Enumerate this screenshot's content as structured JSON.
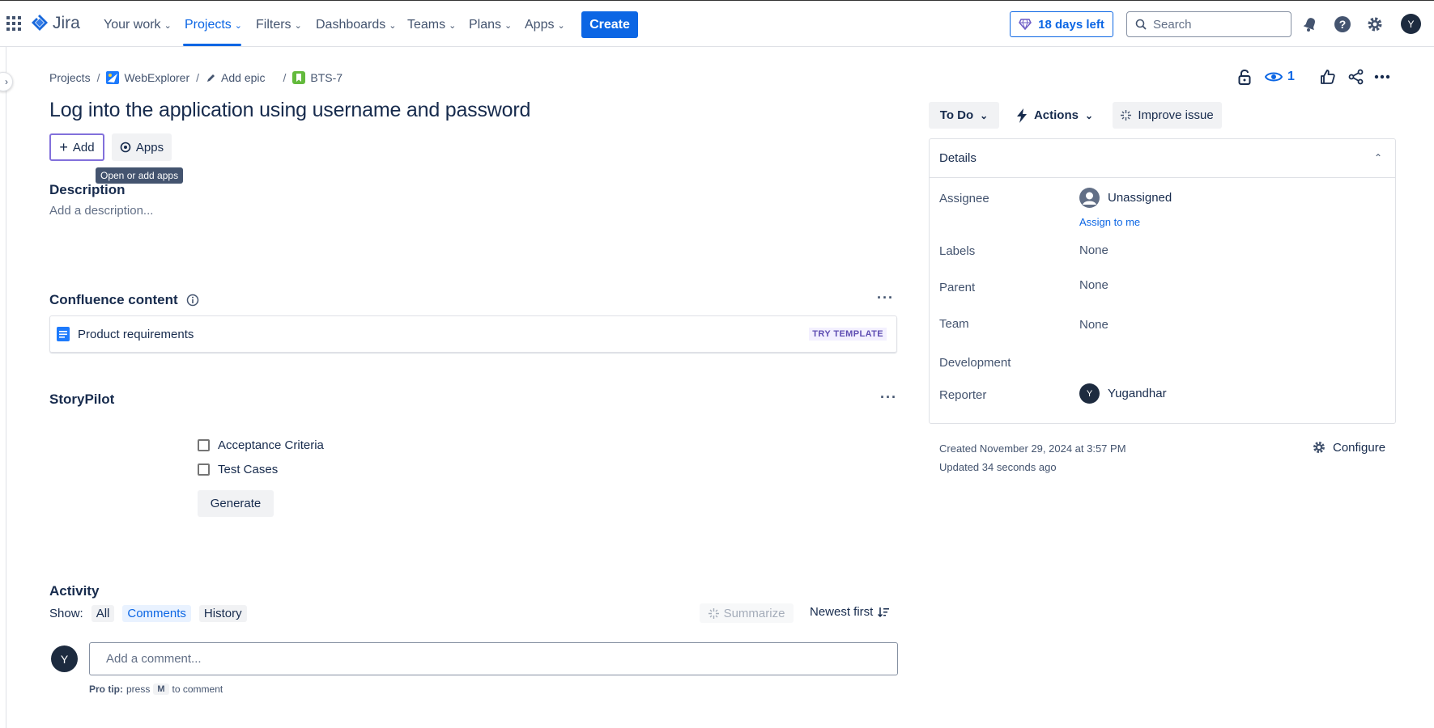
{
  "nav": {
    "logo_text": "Jira",
    "items": [
      {
        "label": "Your work"
      },
      {
        "label": "Projects"
      },
      {
        "label": "Filters"
      },
      {
        "label": "Dashboards"
      },
      {
        "label": "Teams"
      },
      {
        "label": "Plans"
      },
      {
        "label": "Apps"
      }
    ],
    "create_label": "Create",
    "trial_label": "18 days left",
    "search_placeholder": "Search",
    "user_initial": "Y",
    "brand_color": "#0c66e4"
  },
  "breadcrumb": {
    "projects": "Projects",
    "project_name": "WebExplorer",
    "add_epic": "Add epic",
    "issue_key": "BTS-7"
  },
  "issue": {
    "title": "Log into the application using username and password",
    "add_label": "Add",
    "apps_label": "Apps",
    "apps_tooltip": "Open or add apps",
    "watch_count": "1"
  },
  "description": {
    "heading": "Description",
    "placeholder": "Add a description..."
  },
  "confluence": {
    "heading": "Confluence content",
    "item_label": "Product requirements",
    "badge": "TRY TEMPLATE"
  },
  "storypilot": {
    "heading": "StoryPilot",
    "options": [
      "Acceptance Criteria",
      "Test Cases"
    ],
    "generate_label": "Generate"
  },
  "activity": {
    "heading": "Activity",
    "show_label": "Show:",
    "filters": [
      "All",
      "Comments",
      "History"
    ],
    "active_filter": "Comments",
    "summarize_label": "Summarize",
    "sort_label": "Newest first",
    "comment_placeholder": "Add a comment...",
    "pro_tip_bold": "Pro tip:",
    "pro_tip_press": "press",
    "pro_tip_key": "M",
    "pro_tip_rest": "to comment",
    "user_initial": "Y"
  },
  "sidebar": {
    "status_label": "To Do",
    "actions_label": "Actions",
    "improve_label": "Improve issue",
    "details_heading": "Details",
    "fields": {
      "assignee_label": "Assignee",
      "assignee_value": "Unassigned",
      "assign_to_me": "Assign to me",
      "labels_label": "Labels",
      "labels_value": "None",
      "parent_label": "Parent",
      "parent_value": "None",
      "team_label": "Team",
      "team_value": "None",
      "development_label": "Development",
      "reporter_label": "Reporter",
      "reporter_value": "Yugandhar",
      "reporter_initial": "Y"
    },
    "created": "Created November 29, 2024 at 3:57 PM",
    "updated": "Updated 34 seconds ago",
    "configure_label": "Configure"
  }
}
